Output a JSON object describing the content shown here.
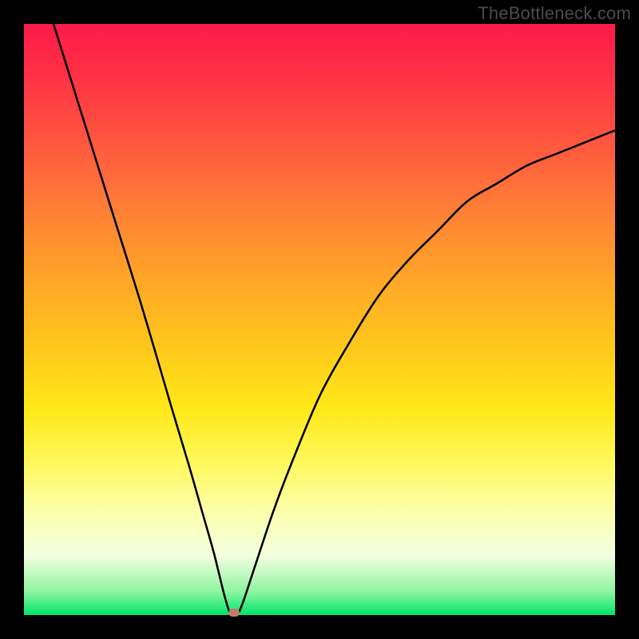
{
  "watermark": "TheBottleneck.com",
  "colors": {
    "background": "#000000",
    "marker": "#c6786e",
    "curve_stroke": "#000000"
  },
  "layout": {
    "image_size": 800,
    "plot_inset": 30,
    "plot_size": 740
  },
  "chart_data": {
    "type": "line",
    "title": "",
    "xlabel": "",
    "ylabel": "",
    "xlim": [
      0,
      100
    ],
    "ylim": [
      0,
      100
    ],
    "x": [
      5,
      10,
      15,
      20,
      25,
      28,
      30,
      32,
      33,
      34,
      35,
      36,
      37,
      39,
      42,
      45,
      50,
      55,
      60,
      65,
      70,
      75,
      80,
      85,
      90,
      95,
      100
    ],
    "values": [
      100,
      84,
      68,
      52,
      35,
      25,
      18,
      11,
      7,
      3,
      0,
      0,
      2,
      8,
      17,
      25,
      37,
      46,
      54,
      60,
      65,
      70,
      73,
      76,
      78,
      80,
      82
    ],
    "minimum_marker": {
      "x": 35.5,
      "y": 0
    },
    "note": "Axis values are in percent of the plot area. Values estimated from pixel positions; no numeric tick labels or axis titles are rendered in the image."
  }
}
